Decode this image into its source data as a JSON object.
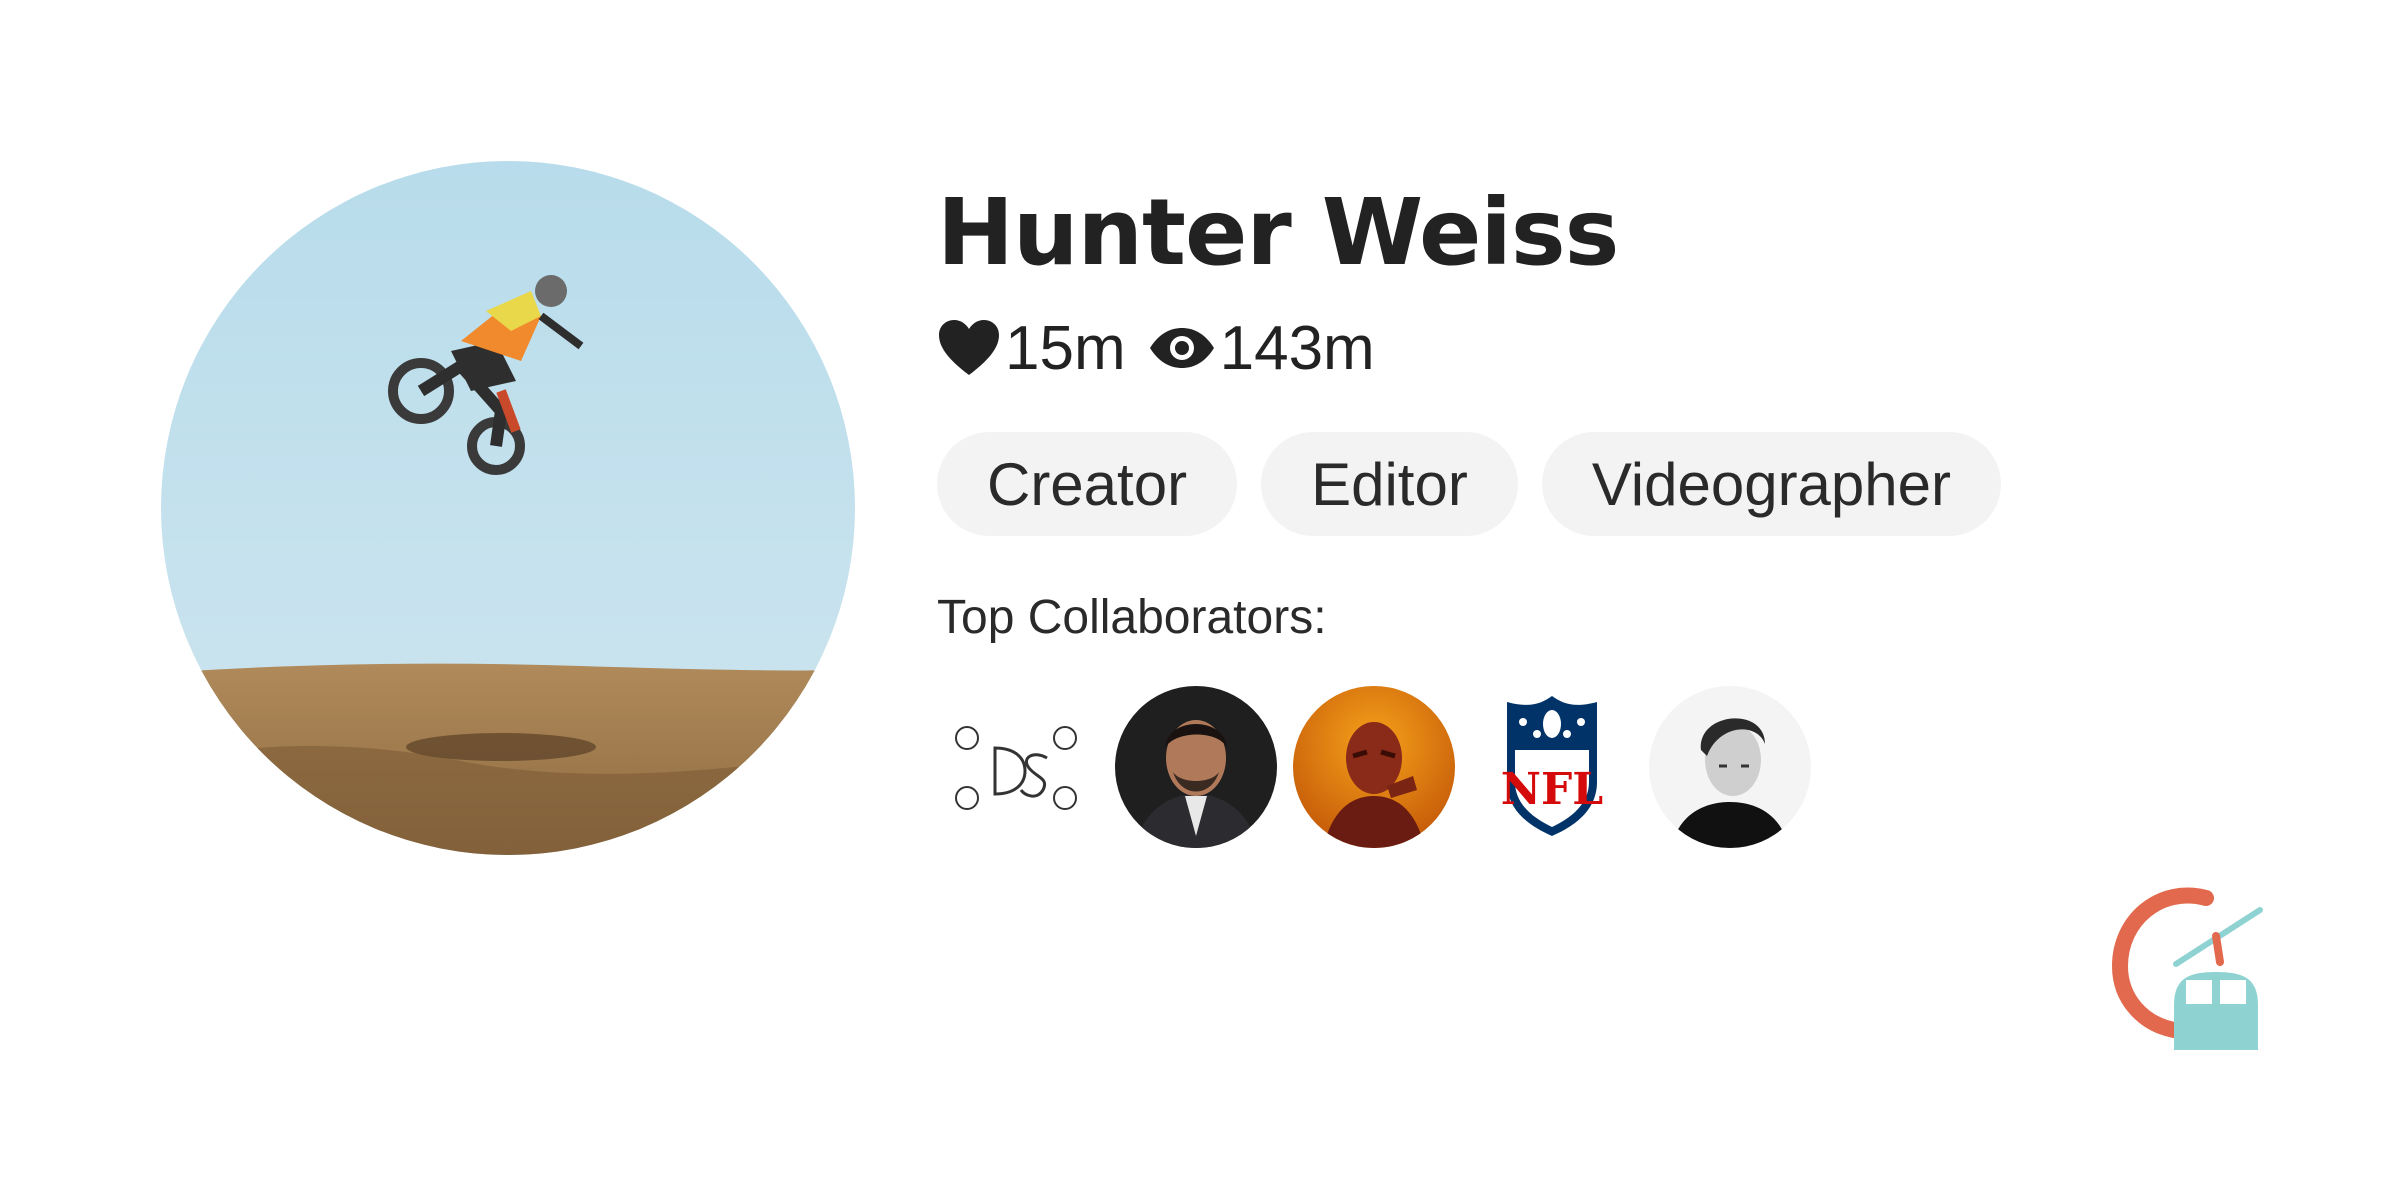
{
  "profile": {
    "name": "Hunter Weiss",
    "likes": "15m",
    "views": "143m"
  },
  "tags": [
    "Creator",
    "Editor",
    "Videographer"
  ],
  "collaborators_label": "Top Collaborators:",
  "collaborators": [
    {
      "name": "ds-brand-logo",
      "kind": "logo"
    },
    {
      "name": "man-in-suit-avatar",
      "kind": "photo"
    },
    {
      "name": "masked-figure-avatar",
      "kind": "photo"
    },
    {
      "name": "nfl-logo",
      "kind": "logo",
      "logo_text": "NFL"
    },
    {
      "name": "bw-portrait-avatar",
      "kind": "photo"
    }
  ],
  "icons": {
    "likes": "heart-icon",
    "views": "eye-icon"
  },
  "colors": {
    "tag_background": "#f3f3f3",
    "text": "#222222",
    "brand_orange": "#e2694d",
    "brand_teal": "#8fd2d2",
    "nfl_blue": "#013369",
    "nfl_red": "#d50a0a"
  }
}
